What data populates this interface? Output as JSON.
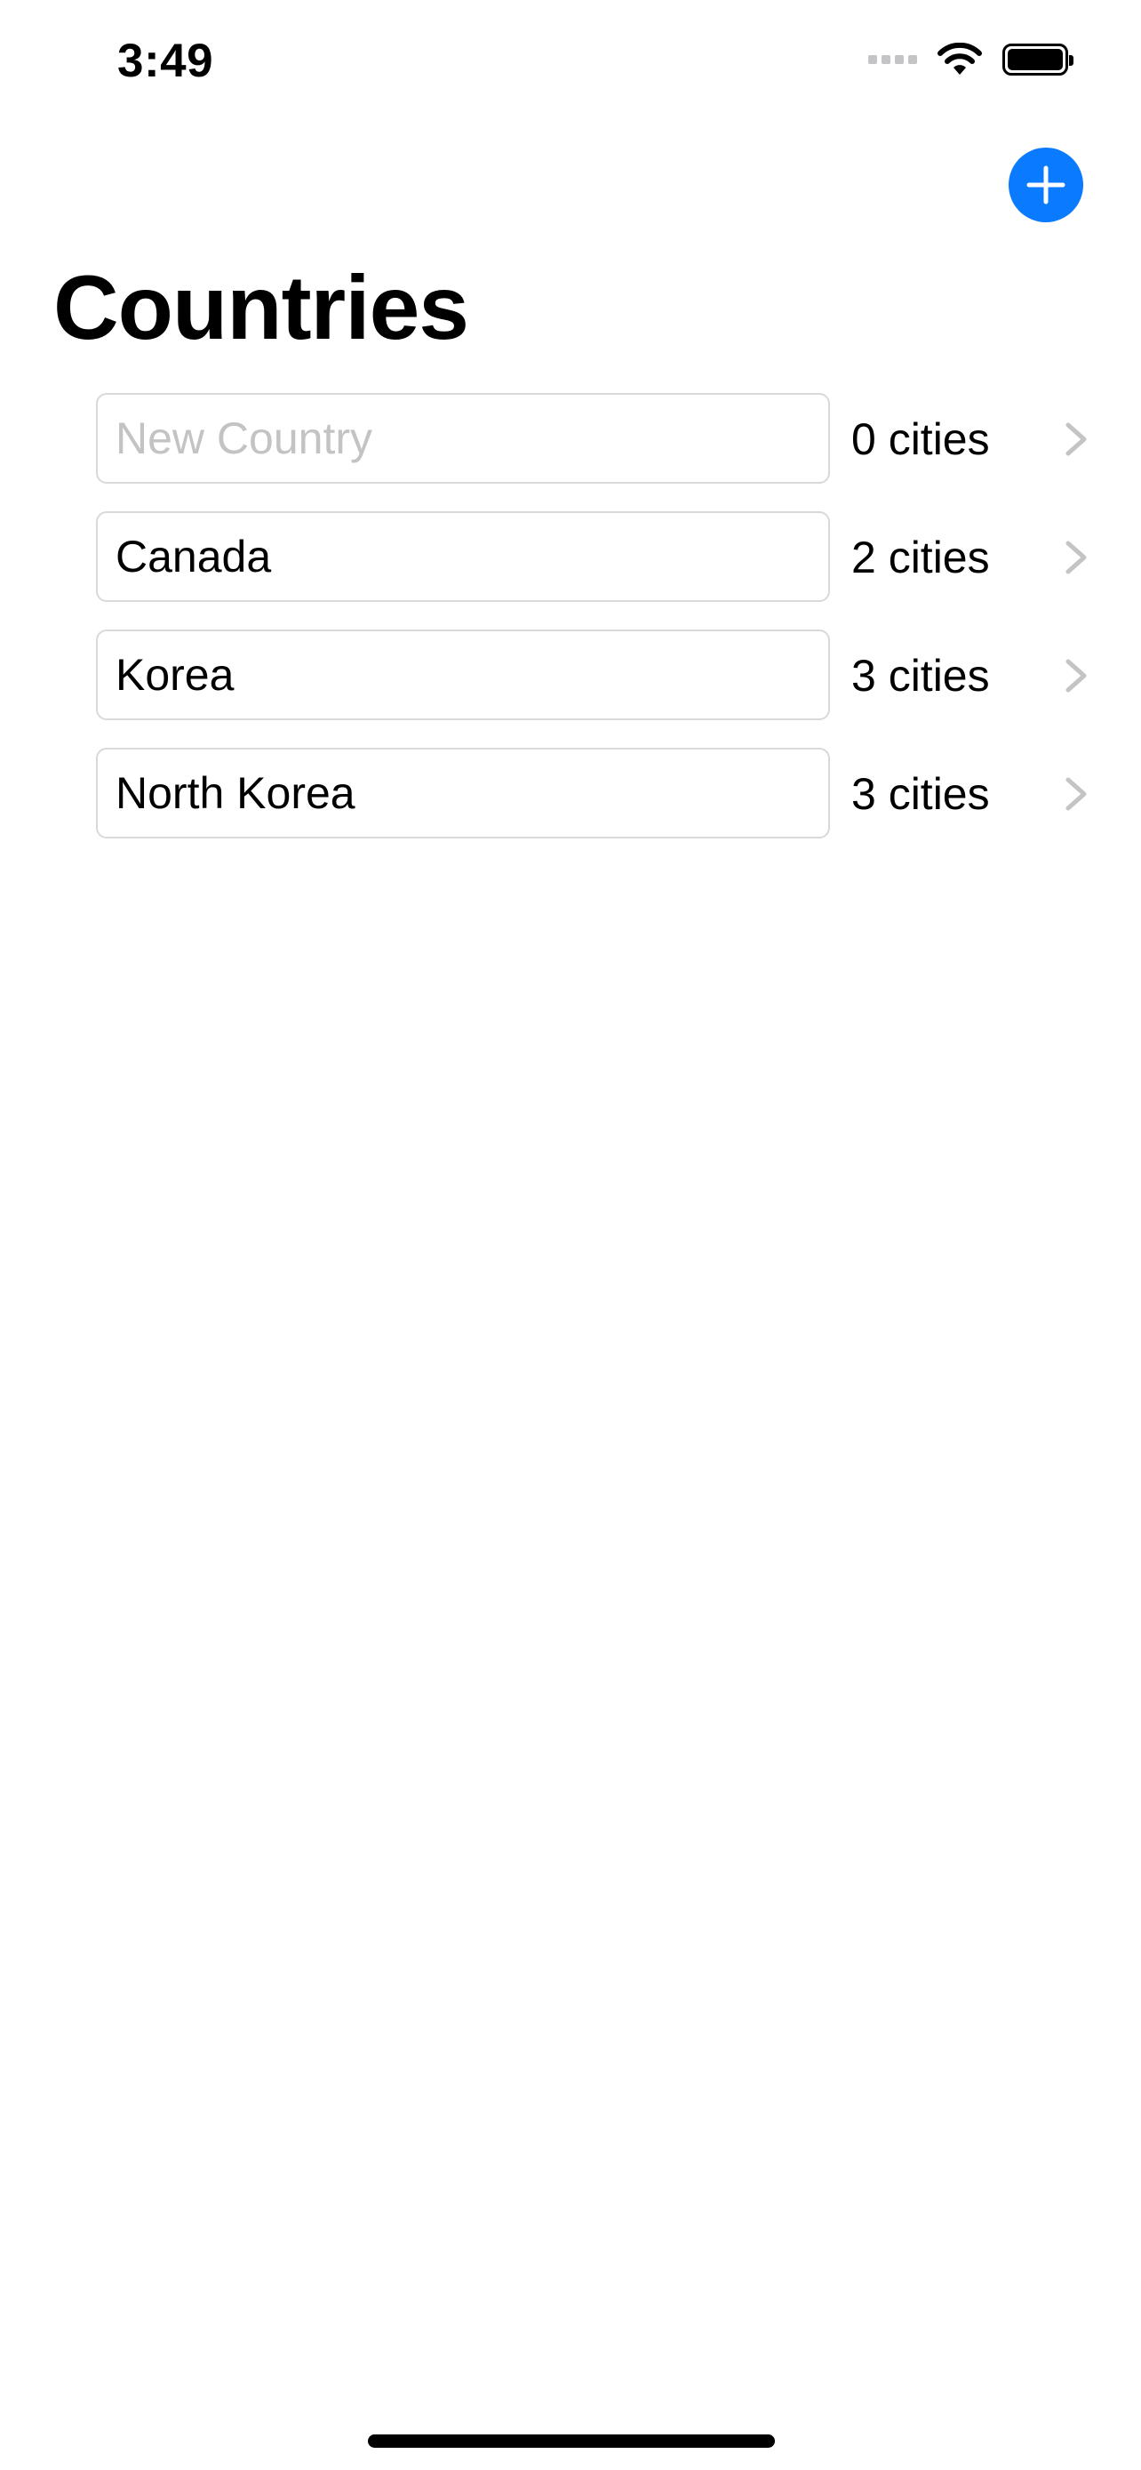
{
  "status_bar": {
    "time": "3:49",
    "icons": [
      "cellular-signal-icon",
      "wifi-icon",
      "battery-icon"
    ]
  },
  "nav": {
    "add_button_icon": "plus-icon",
    "accent_color": "#0a7aff"
  },
  "page": {
    "title": "Countries"
  },
  "countries": [
    {
      "name": "",
      "placeholder": "New Country",
      "cities": "0 cities"
    },
    {
      "name": "Canada",
      "placeholder": "",
      "cities": "2 cities"
    },
    {
      "name": "Korea",
      "placeholder": "",
      "cities": "3 cities"
    },
    {
      "name": "North Korea",
      "placeholder": "",
      "cities": "3 cities"
    }
  ]
}
